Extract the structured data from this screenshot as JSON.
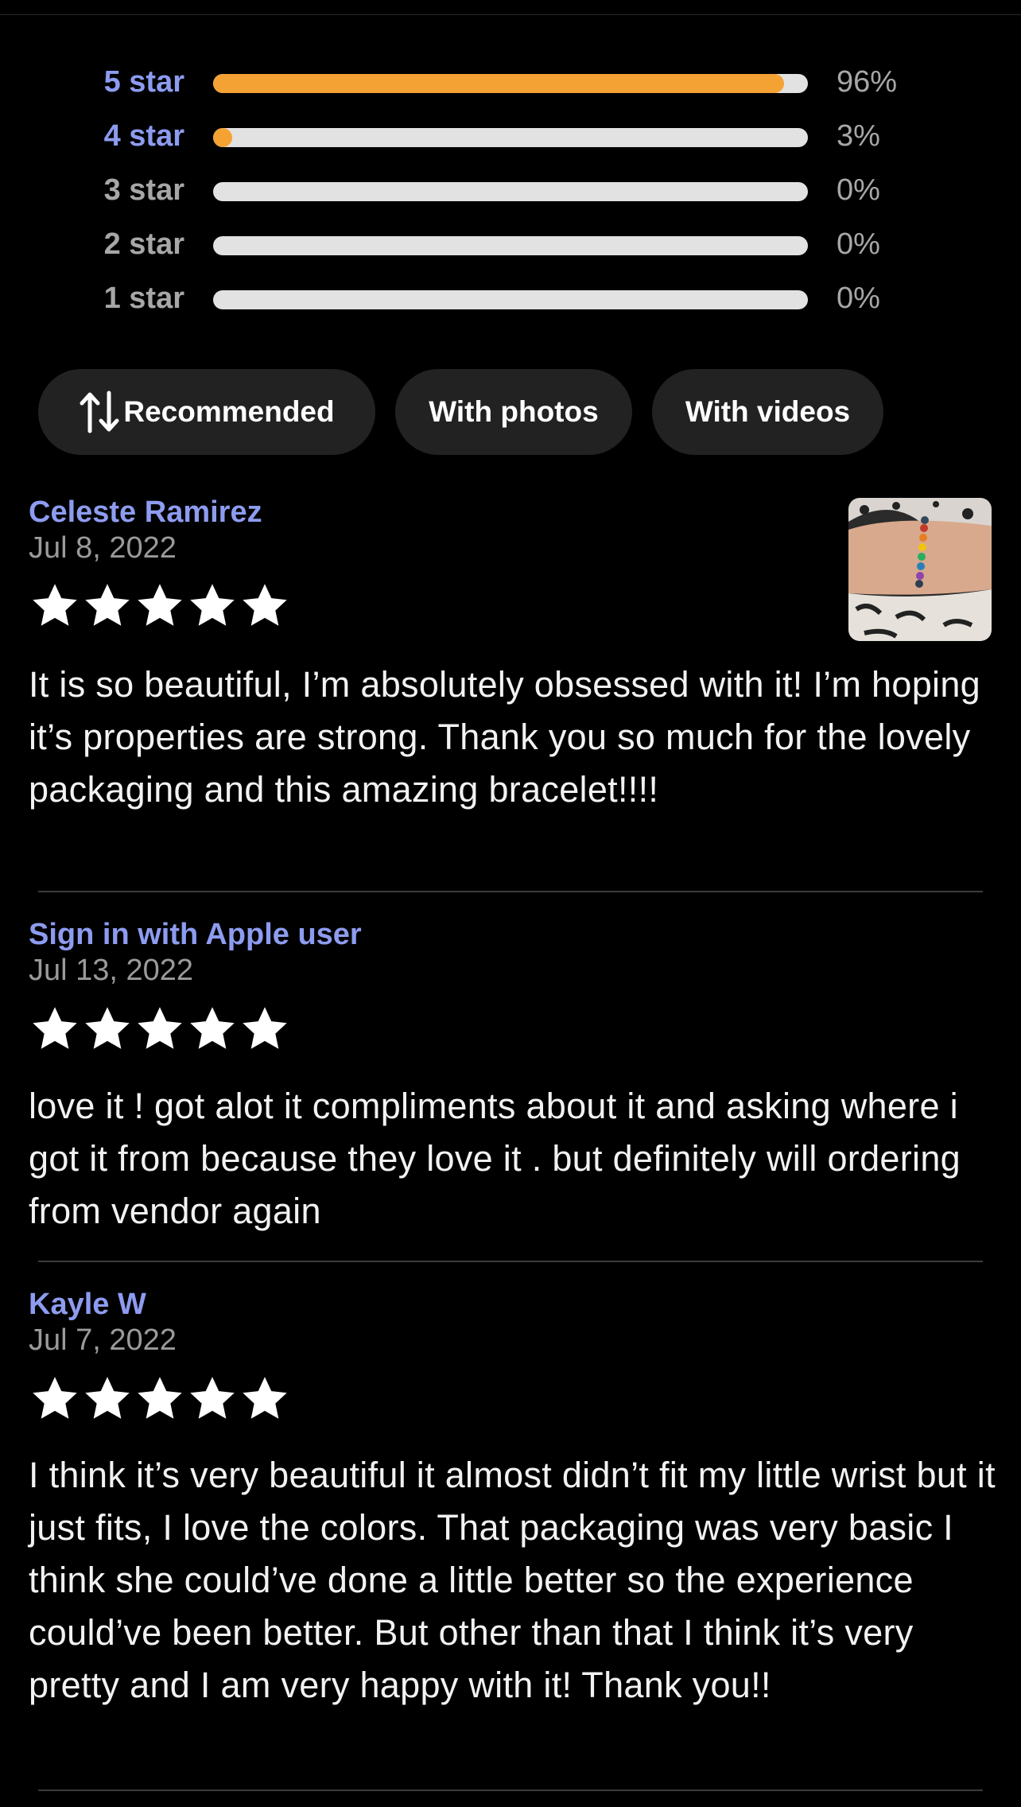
{
  "rating_breakdown": [
    {
      "label": "5 star",
      "percent_text": "96%",
      "fill": 0.96,
      "active": true
    },
    {
      "label": "4 star",
      "percent_text": "3%",
      "fill": 0.03,
      "active": true
    },
    {
      "label": "3 star",
      "percent_text": "0%",
      "fill": 0,
      "active": false
    },
    {
      "label": "2 star",
      "percent_text": "0%",
      "fill": 0,
      "active": false
    },
    {
      "label": "1 star",
      "percent_text": "0%",
      "fill": 0,
      "active": false
    }
  ],
  "filters": {
    "sort_icon": "sort-arrows-icon",
    "recommended_label": "Recommended",
    "photos_label": "With photos",
    "videos_label": "With videos"
  },
  "reviews": [
    {
      "name": "Celeste Ramirez",
      "date": "Jul 8, 2022",
      "stars": 5,
      "text": "It is so beautiful, I’m absolutely obsessed with it! I’m hoping it’s properties are strong. Thank you so much for the lovely packaging and this amazing bracelet!!!!",
      "has_photo": true
    },
    {
      "name": "Sign in with Apple user",
      "date": "Jul 13, 2022",
      "stars": 5,
      "text": "love it ! got alot it compliments about it and asking where i got it from because they love it . but definitely will ordering from vendor again",
      "has_photo": false
    },
    {
      "name": "Kayle W",
      "date": "Jul 7, 2022",
      "stars": 5,
      "text": "I think it’s very beautiful it almost didn’t fit my little wrist but it just fits, I love the colors. That packaging was very basic I think she could’ve done a little better so the experience could’ve been better. But other than that I think it’s very pretty and I am very happy with it! Thank you!!",
      "has_photo": false
    }
  ],
  "colors": {
    "accent": "#8d9cf0",
    "bar_fill": "#f5a234",
    "bar_track": "#e2e2e2",
    "background": "#000000",
    "chip": "#222222"
  }
}
